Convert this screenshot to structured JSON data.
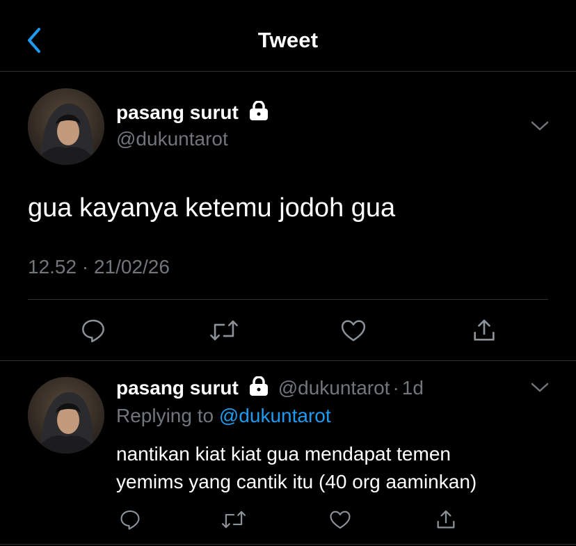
{
  "header": {
    "title": "Tweet",
    "back_icon": "chevron-left-icon",
    "accent": "#1d9bf0"
  },
  "tweet": {
    "name": "pasang surut",
    "handle": "@dukuntarot",
    "text": "gua kayanya ketemu jodoh gua",
    "timestamp": "12.52 · 21/02/26",
    "protected": true
  },
  "actions": [
    "reply-icon",
    "retweet-icon",
    "like-icon",
    "share-icon"
  ],
  "reply": {
    "name": "pasang surut",
    "handle": "@dukuntarot",
    "separator": "·",
    "age": "1d",
    "replying_prefix": "Replying to",
    "replying_to": "@dukuntarot",
    "line1": "nantikan kiat kiat gua mendapat temen",
    "line2": "yemims yang cantik itu (40 org aaminkan)"
  },
  "colors": {
    "background": "#000000",
    "text": "#ffffff",
    "muted": "#71767b",
    "divider": "#2f3336",
    "link": "#1d9bf0"
  }
}
